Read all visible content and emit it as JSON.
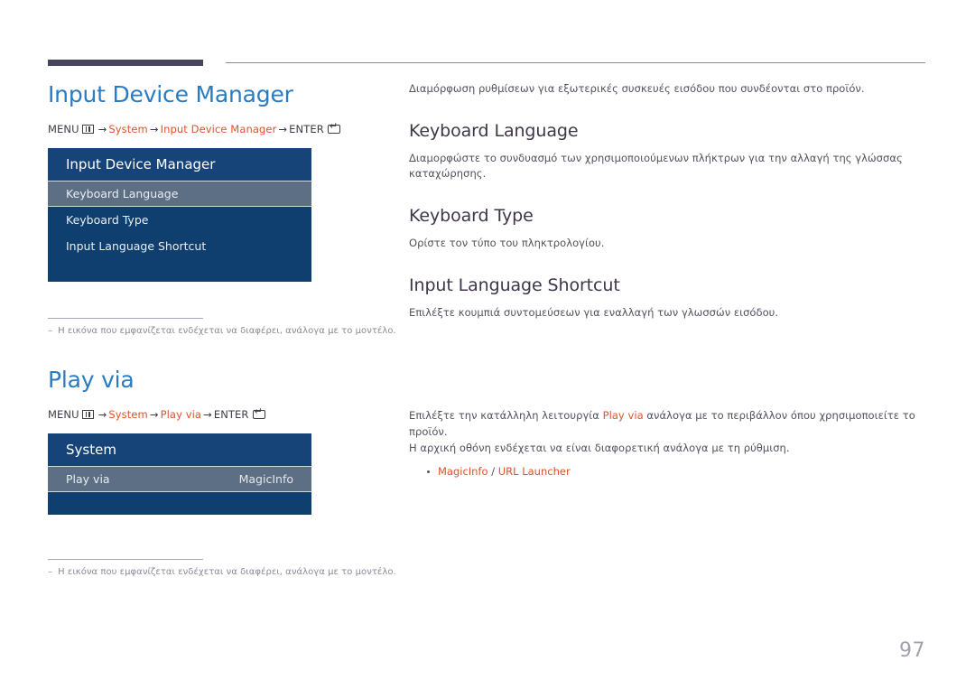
{
  "colors": {
    "accent_blue": "#2a7bc0",
    "accent_orange": "#e0522c",
    "osd_header": "#174478",
    "osd_body": "#0f3f6e",
    "osd_selected": "#5d6f85",
    "heading_dark": "#3f3648",
    "body_text": "#55505e",
    "footnote": "#8b8a97",
    "rule_dark": "#44445c"
  },
  "sections": [
    {
      "title": "Input Device Manager",
      "menu_path": {
        "menu_label": "MENU",
        "menu_icon": "menu-grid-icon",
        "items": [
          "System",
          "Input Device Manager"
        ],
        "enter_label": "ENTER",
        "enter_icon": "enter-key-icon",
        "arrow": "→"
      },
      "osd": {
        "header": "Input Device Manager",
        "rows": [
          {
            "label": "Keyboard Language",
            "value": "",
            "selected": true
          },
          {
            "label": "Keyboard Type",
            "value": "",
            "selected": false
          },
          {
            "label": "Input Language Shortcut",
            "value": "",
            "selected": false
          }
        ]
      },
      "footnote": {
        "dash": "–",
        "text": "Η εικόνα που εμφανίζεται ενδέχεται να διαφέρει, ανάλογα με το μοντέλο."
      }
    },
    {
      "title": "Play via",
      "menu_path": {
        "menu_label": "MENU",
        "menu_icon": "menu-grid-icon",
        "items": [
          "System",
          "Play via"
        ],
        "enter_label": "ENTER",
        "enter_icon": "enter-key-icon",
        "arrow": "→"
      },
      "osd": {
        "header": "System",
        "rows": [
          {
            "label": "Play via",
            "value": "MagicInfo",
            "selected": true
          }
        ]
      },
      "footnote": {
        "dash": "–",
        "text": "Η εικόνα που εμφανίζεται ενδέχεται να διαφέρει, ανάλογα με το μοντέλο."
      }
    }
  ],
  "right_column": {
    "intro": "Διαμόρφωση ρυθμίσεων για εξωτερικές συσκευές εισόδου που συνδέονται στο προϊόν.",
    "subsections": [
      {
        "heading": "Keyboard Language",
        "text": "Διαμορφώστε το συνδυασμό των χρησιμοποιούμενων πλήκτρων για την αλλαγή της γλώσσας καταχώρησης."
      },
      {
        "heading": "Keyboard Type",
        "text": "Ορίστε τον τύπο του πληκτρολογίου."
      },
      {
        "heading": "Input Language Shortcut",
        "text": "Επιλέξτε κουμπιά συντομεύσεων για εναλλαγή των γλωσσών εισόδου."
      }
    ],
    "play_via": {
      "line1_part1": "Επιλέξτε την κατάλληλη λειτουργία",
      "line1_accent": "Play via",
      "line1_part2": "ανάλογα με το περιβάλλον όπου χρησιμοποιείτε το προϊόν.",
      "line2": "Η αρχική οθόνη ενδέχεται να είναι διαφορετική ανάλογα με τη ρύθμιση.",
      "bullet_option1": "MagicInfo",
      "bullet_separator": "/",
      "bullet_option2": "URL Launcher"
    }
  },
  "page_number": "97"
}
